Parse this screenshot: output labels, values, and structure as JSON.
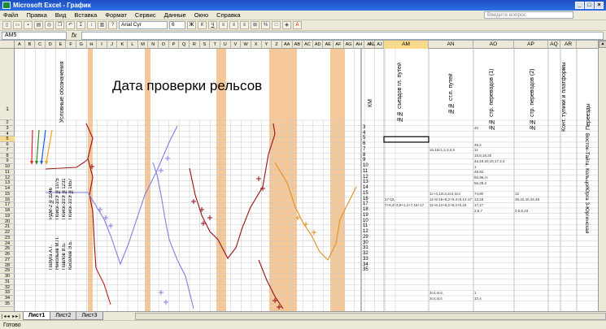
{
  "window": {
    "title": "Microsoft Excel - График"
  },
  "menu": {
    "items": [
      "Файл",
      "Правка",
      "Вид",
      "Вставка",
      "Формат",
      "Сервис",
      "Данные",
      "Окно",
      "Справка"
    ],
    "help_placeholder": "Введите вопрос"
  },
  "toolbar": {
    "font": "Arial Cyr",
    "size": "6"
  },
  "formula": {
    "namebox": "AM5",
    "fx": "fx",
    "value": ""
  },
  "columns": {
    "left": [
      "A",
      "B",
      "C",
      "D",
      "E",
      "F",
      "G",
      "H",
      "I",
      "J",
      "K",
      "L",
      "M",
      "N",
      "O",
      "P",
      "Q",
      "R",
      "S",
      "T",
      "U",
      "V",
      "W",
      "X",
      "Y",
      "Z",
      "AA",
      "AB",
      "AC",
      "AD",
      "AE",
      "AF",
      "AG",
      "AH",
      "AI",
      "AJ",
      "AK"
    ],
    "right": [
      "AL",
      "AM",
      "AN",
      "AO",
      "AP",
      "AQ",
      "AR"
    ],
    "selected": "AM"
  },
  "rows": {
    "labels": [
      "1",
      "2",
      "3",
      "4",
      "5",
      "6",
      "7",
      "8",
      "9",
      "10",
      "11",
      "12",
      "13",
      "14",
      "15",
      "16",
      "17",
      "18",
      "19",
      "20",
      "21",
      "22",
      "23",
      "24",
      "25",
      "26",
      "27",
      "28",
      "29",
      "30",
      "31",
      "32",
      "33",
      "34",
      "35"
    ],
    "selected": "5"
  },
  "sheet": {
    "chart_title": "Дата проверки рельсов",
    "legend_header": "Условные обозначения",
    "legend_items": [
      "РДМ-2 №3246",
      "Поиск-10Э №1075",
      "Поиск-10Э №1231",
      "Поиск-10Э №1657"
    ],
    "legend_colors": [
      "#e82020",
      "#3a8a2a",
      "#2060e0",
      "#f0a010"
    ],
    "operators": [
      "Папуга А.Г.",
      "Никольев М.П.",
      "Павлов В.Б.",
      "Киселев Э.Б."
    ],
    "headers": {
      "km": "КМ",
      "main_track": "№№ съездов гл. путей",
      "station_tracks": "№№ ст.п. путей",
      "switches_1": "№№ стр. переводов (1)",
      "switches_2": "№№ стр. переводов (2)",
      "special": "Конт. тупики и платформы",
      "crossings": "Переезды"
    },
    "crossings_text": "Восток-Тайга, Кольцо/Юрга 3-Юргинская",
    "km_values": [
      "3",
      "4",
      "5",
      "6",
      "7",
      "8",
      "9",
      "10",
      "11",
      "12",
      "13",
      "14",
      "15",
      "16",
      "17",
      "18",
      "19",
      "10",
      "11",
      "12",
      "29",
      "30",
      "31",
      "32",
      "33",
      "34",
      "35"
    ],
    "cell_snippets": [
      {
        "row": 7,
        "col": "AN",
        "text": "15,10с1,2,3,4,5"
      },
      {
        "row": 16,
        "col": "AM",
        "text": "17-15,"
      },
      {
        "row": 16,
        "col": "AN",
        "text": "11+8-15+8,2+8,4+8,12-17"
      },
      {
        "row": 17,
        "col": "AM",
        "text": "7+8,4+3,9+1,2+7,16+17"
      },
      {
        "row": 17,
        "col": "AN",
        "text": "11+8,13+8,2+8,4+8,15"
      },
      {
        "row": 15,
        "col": "AN",
        "text": "1с+4,12с4,2с4,4с4"
      },
      {
        "row": 33,
        "col": "AN",
        "text": "3с4,4с4,"
      },
      {
        "row": 34,
        "col": "AN",
        "text": "3с4,4с4"
      },
      {
        "row": 3,
        "col": "AO",
        "text": "40"
      },
      {
        "row": 6,
        "col": "AO",
        "text": "46,2"
      },
      {
        "row": 7,
        "col": "AO",
        "text": "11"
      },
      {
        "row": 8,
        "col": "AO",
        "text": "18,8,16,20"
      },
      {
        "row": 9,
        "col": "AO",
        "text": "4а,19,20,10,17,2,3"
      },
      {
        "row": 10,
        "col": "AO",
        "text": "1"
      },
      {
        "row": 11,
        "col": "AO",
        "text": "48,92"
      },
      {
        "row": 12,
        "col": "AO",
        "text": "92,98,гл"
      },
      {
        "row": 13,
        "col": "AO",
        "text": "56,28,4"
      },
      {
        "row": 15,
        "col": "AO",
        "text": "74,80"
      },
      {
        "row": 16,
        "col": "AO",
        "text": "13,18"
      },
      {
        "row": 17,
        "col": "AO",
        "text": "17,17"
      },
      {
        "row": 18,
        "col": "AO",
        "text": "3,5,7"
      },
      {
        "row": 33,
        "col": "AO",
        "text": "1"
      },
      {
        "row": 34,
        "col": "AO",
        "text": "10,4"
      },
      {
        "row": 15,
        "col": "AP",
        "text": "12"
      },
      {
        "row": 16,
        "col": "AP",
        "text": "35,42,40,44,46"
      },
      {
        "row": 18,
        "col": "AP",
        "text": "3,5,6,43"
      }
    ]
  },
  "tabs": [
    "Лист1",
    "Лист2",
    "Лист3"
  ],
  "status": {
    "text": "Готово"
  }
}
